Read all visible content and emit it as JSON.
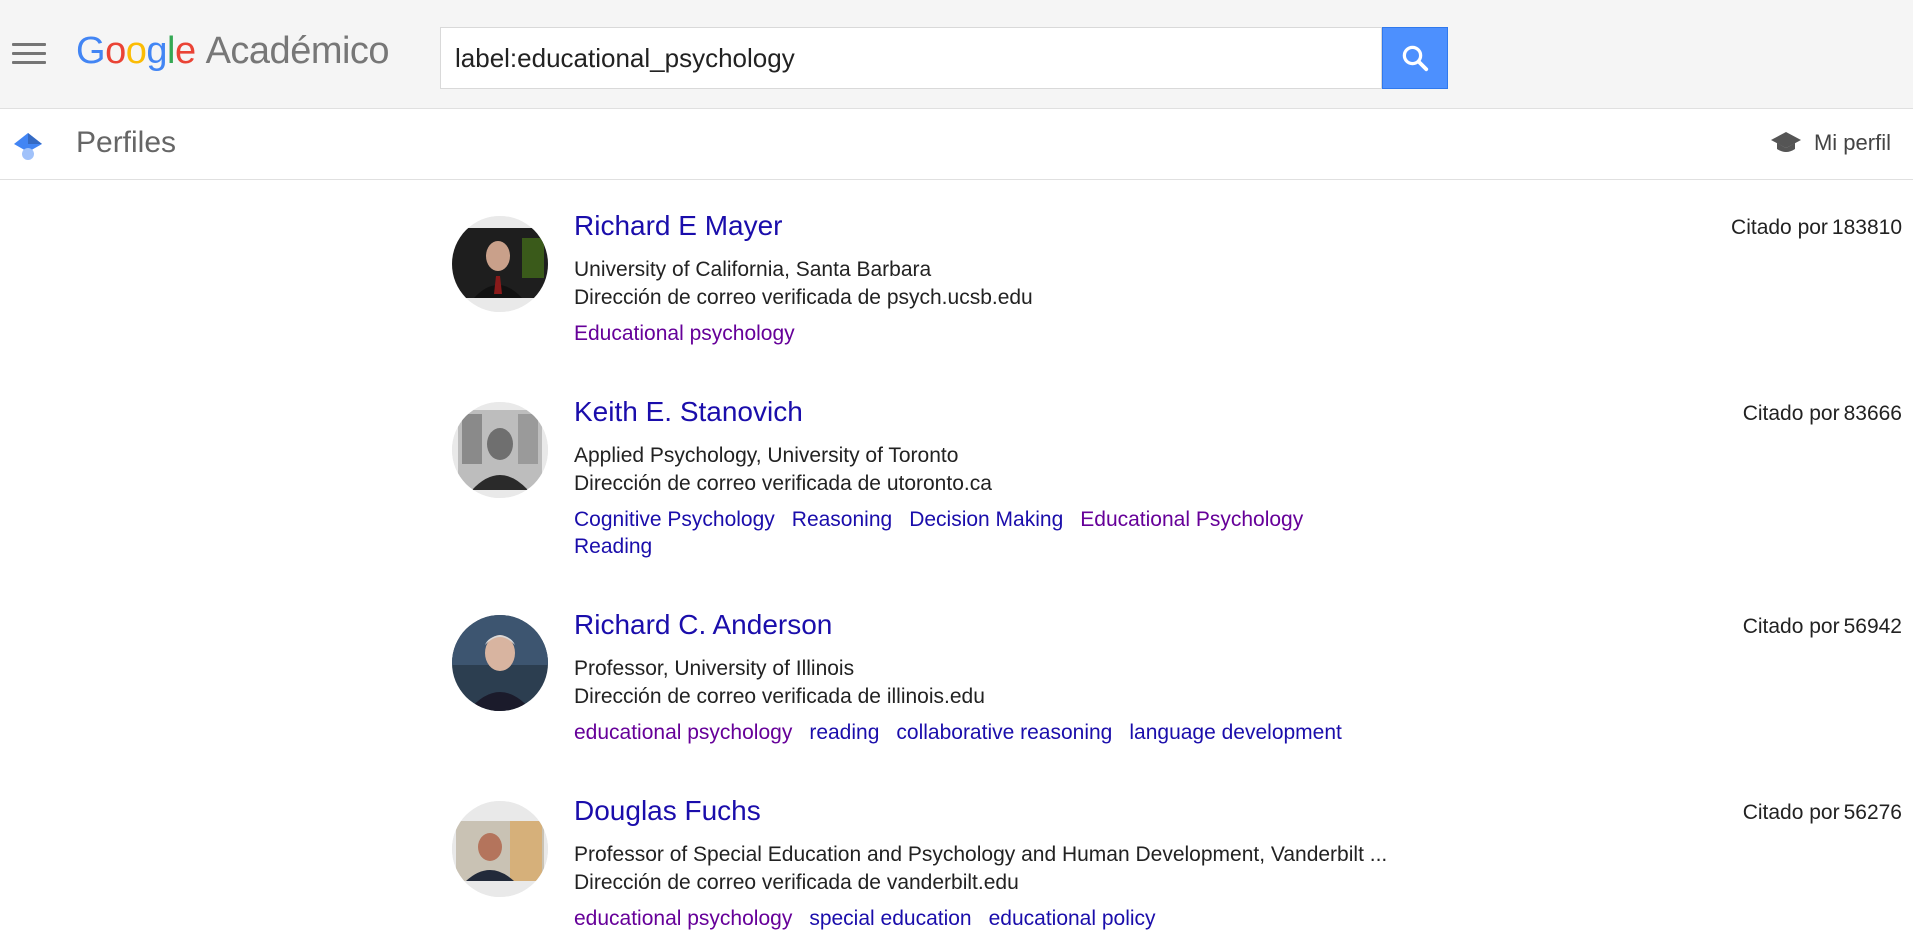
{
  "app": {
    "logo_google": "Google",
    "logo_product": "Académico"
  },
  "search": {
    "query": "label:educational_psychology"
  },
  "subbar": {
    "title": "Perfiles",
    "my_profile": "Mi perfil"
  },
  "cited_label": "Citado por",
  "profiles": [
    {
      "name": "Richard E Mayer",
      "affiliation": "University of California, Santa Barbara",
      "email": "Dirección de correo verificada de psych.ucsb.edu",
      "cited_by": "183810",
      "tags": [
        {
          "label": "Educational psychology",
          "visited": true
        }
      ]
    },
    {
      "name": "Keith E. Stanovich",
      "affiliation": "Applied Psychology, University of Toronto",
      "email": "Dirección de correo verificada de utoronto.ca",
      "cited_by": "83666",
      "tags": [
        {
          "label": "Cognitive Psychology",
          "visited": false
        },
        {
          "label": "Reasoning",
          "visited": false
        },
        {
          "label": "Decision Making",
          "visited": false
        },
        {
          "label": "Educational Psychology",
          "visited": true
        },
        {
          "label": "Reading",
          "visited": false
        }
      ]
    },
    {
      "name": "Richard C. Anderson",
      "affiliation": "Professor, University of Illinois",
      "email": "Dirección de correo verificada de illinois.edu",
      "cited_by": "56942",
      "tags": [
        {
          "label": "educational psychology",
          "visited": true
        },
        {
          "label": "reading",
          "visited": false
        },
        {
          "label": "collaborative reasoning",
          "visited": false
        },
        {
          "label": "language development",
          "visited": false
        }
      ]
    },
    {
      "name": "Douglas Fuchs",
      "affiliation": "Professor of Special Education and Psychology and Human Development, Vanderbilt ...",
      "email": "Dirección de correo verificada de vanderbilt.edu",
      "cited_by": "56276",
      "tags": [
        {
          "label": "educational psychology",
          "visited": true
        },
        {
          "label": "special education",
          "visited": false
        },
        {
          "label": "educational policy",
          "visited": false
        }
      ]
    }
  ],
  "colors": {
    "link": "#1a0dab",
    "visited_link": "#660099",
    "search_button": "#4d90fe"
  }
}
